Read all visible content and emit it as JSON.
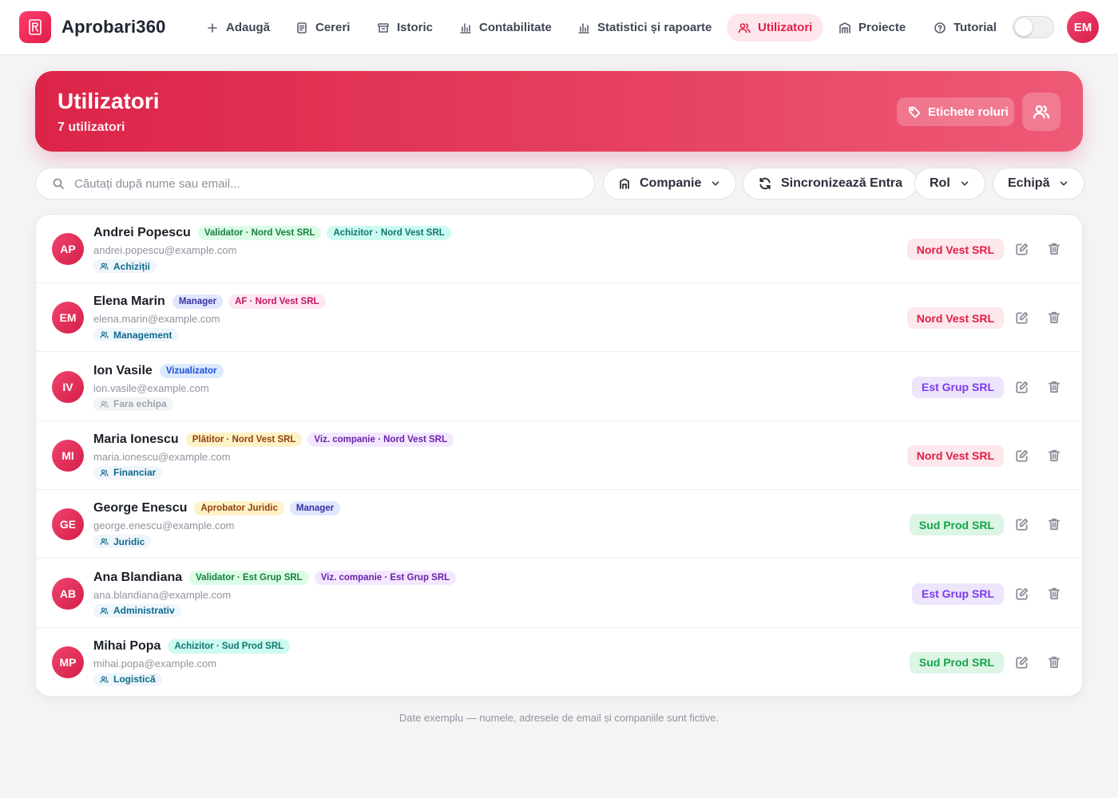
{
  "app": {
    "title": "Aprobari360",
    "user_initials": "EM"
  },
  "nav": [
    {
      "label": "Adaugă",
      "icon": "plus-icon",
      "active": false
    },
    {
      "label": "Cereri",
      "icon": "document-icon",
      "active": false
    },
    {
      "label": "Istoric",
      "icon": "archive-icon",
      "active": false
    },
    {
      "label": "Contabilitate",
      "icon": "bar-chart-icon",
      "active": false
    },
    {
      "label": "Statistici și rapoarte",
      "icon": "bar-chart-icon",
      "active": false
    },
    {
      "label": "Utilizatori",
      "icon": "users-icon",
      "active": true
    },
    {
      "label": "Proiecte",
      "icon": "building-icon",
      "active": false
    },
    {
      "label": "Tutorial",
      "icon": "help-circle-icon",
      "active": false
    }
  ],
  "header": {
    "title": "Utilizatori",
    "subtitle": "7 utilizatori",
    "role_tags_label": "Etichete roluri"
  },
  "filters": {
    "search_placeholder": "Căutați după nume sau email...",
    "company_label": "Companie",
    "sync_label": "Sincronizează Entra",
    "role_label": "Rol",
    "team_label": "Echipă"
  },
  "colors": {
    "accent": "#e11d48",
    "badge_green": {
      "bg": "#dcfce7",
      "fg": "#15803d"
    },
    "badge_teal": {
      "bg": "#ccfbf1",
      "fg": "#0f766e"
    },
    "badge_indigo": {
      "bg": "#e0e7ff",
      "fg": "#3730a3"
    },
    "badge_pink": {
      "bg": "#fce7f3",
      "fg": "#be185d"
    },
    "badge_blue": {
      "bg": "#dbeafe",
      "fg": "#1d4ed8"
    },
    "badge_amber": {
      "bg": "#fef3c7",
      "fg": "#92400e"
    },
    "badge_purple": {
      "bg": "#f3e8ff",
      "fg": "#6b21a8"
    }
  },
  "users": [
    {
      "initials": "AP",
      "name": "Andrei Popescu",
      "email": "andrei.popescu@example.com",
      "roles": [
        {
          "label": "Validator · Nord Vest SRL",
          "color": "green"
        },
        {
          "label": "Achizitor · Nord Vest SRL",
          "color": "teal"
        }
      ],
      "team": "Achiziții",
      "has_team": true,
      "company": "Nord Vest SRL",
      "company_color": "red"
    },
    {
      "initials": "EM",
      "name": "Elena Marin",
      "email": "elena.marin@example.com",
      "roles": [
        {
          "label": "Manager",
          "color": "indigo"
        },
        {
          "label": "AF · Nord Vest SRL",
          "color": "pink"
        }
      ],
      "team": "Management",
      "has_team": true,
      "company": "Nord Vest SRL",
      "company_color": "red"
    },
    {
      "initials": "IV",
      "name": "Ion Vasile",
      "email": "ion.vasile@example.com",
      "roles": [
        {
          "label": "Vizualizator",
          "color": "blue"
        }
      ],
      "team": "Fara echipa",
      "has_team": false,
      "company": "Est Grup SRL",
      "company_color": "purple"
    },
    {
      "initials": "MI",
      "name": "Maria Ionescu",
      "email": "maria.ionescu@example.com",
      "roles": [
        {
          "label": "Plătitor · Nord Vest SRL",
          "color": "amber"
        },
        {
          "label": "Viz. companie · Nord Vest SRL",
          "color": "purple"
        }
      ],
      "team": "Financiar",
      "has_team": true,
      "company": "Nord Vest SRL",
      "company_color": "red"
    },
    {
      "initials": "GE",
      "name": "George Enescu",
      "email": "george.enescu@example.com",
      "roles": [
        {
          "label": "Aprobator Juridic",
          "color": "amber"
        },
        {
          "label": "Manager",
          "color": "indigo"
        }
      ],
      "team": "Juridic",
      "has_team": true,
      "company": "Sud Prod SRL",
      "company_color": "green"
    },
    {
      "initials": "AB",
      "name": "Ana Blandiana",
      "email": "ana.blandiana@example.com",
      "roles": [
        {
          "label": "Validator · Est Grup SRL",
          "color": "green"
        },
        {
          "label": "Viz. companie · Est Grup SRL",
          "color": "purple"
        }
      ],
      "team": "Administrativ",
      "has_team": true,
      "company": "Est Grup SRL",
      "company_color": "purple"
    },
    {
      "initials": "MP",
      "name": "Mihai Popa",
      "email": "mihai.popa@example.com",
      "roles": [
        {
          "label": "Achizitor · Sud Prod SRL",
          "color": "teal"
        }
      ],
      "team": "Logistică",
      "has_team": true,
      "company": "Sud Prod SRL",
      "company_color": "green"
    }
  ],
  "footer_note": "Date exemplu — numele, adresele de email și companiile sunt fictive."
}
